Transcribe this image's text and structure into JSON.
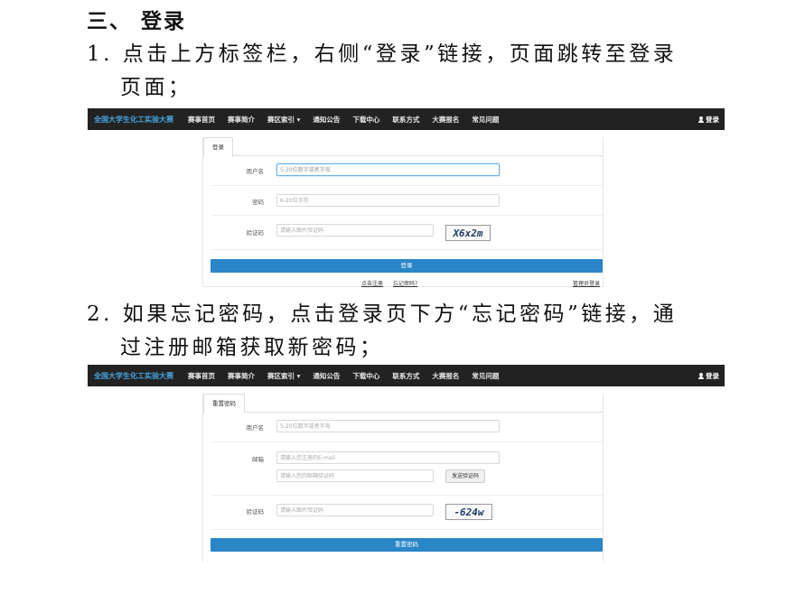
{
  "section": {
    "heading": "三、 登录"
  },
  "step1": {
    "line1": "1. 点击上方标签栏，右侧“登录”链接，页面跳转至登录",
    "line2": "页面；"
  },
  "step2": {
    "line1": "2. 如果忘记密码，点击登录页下方“忘记密码”链接，通",
    "line2": "过注册邮箱获取新密码；"
  },
  "navbar": {
    "brand": "全国大学生化工实验大赛",
    "items": [
      "赛事首页",
      "赛事简介",
      "赛区索引 ▾",
      "通知公告",
      "下载中心",
      "联系方式",
      "大赛报名",
      "常见问题"
    ],
    "login": "登录"
  },
  "login_form": {
    "tab": "登录",
    "username_label": "用户名",
    "username_placeholder": "5-20位数字或者字母",
    "password_label": "密码",
    "password_placeholder": "6-20位字符",
    "captcha_label": "验证码",
    "captcha_placeholder": "请输入图片验证码",
    "captcha_text": "X6x2m",
    "submit": "登录",
    "register_link": "点击注册",
    "forgot_link": "忘记密码?",
    "admin_link": "管理员登录"
  },
  "reset_form": {
    "tab": "重置密码",
    "username_label": "用户名",
    "username_placeholder": "5-20位数字或者字母",
    "email_label": "邮箱",
    "email_placeholder": "请输入您注册的E-mail",
    "email_code_placeholder": "请输入您的邮箱验证码",
    "send_code": "发送验证码",
    "captcha_label": "验证码",
    "captcha_placeholder": "请输入图片验证码",
    "captcha_text": "-624w",
    "submit": "重置密码"
  },
  "colors": {
    "navbar_bg": "#222222",
    "brand": "#4aa3df",
    "primary": "#2a86c7"
  }
}
